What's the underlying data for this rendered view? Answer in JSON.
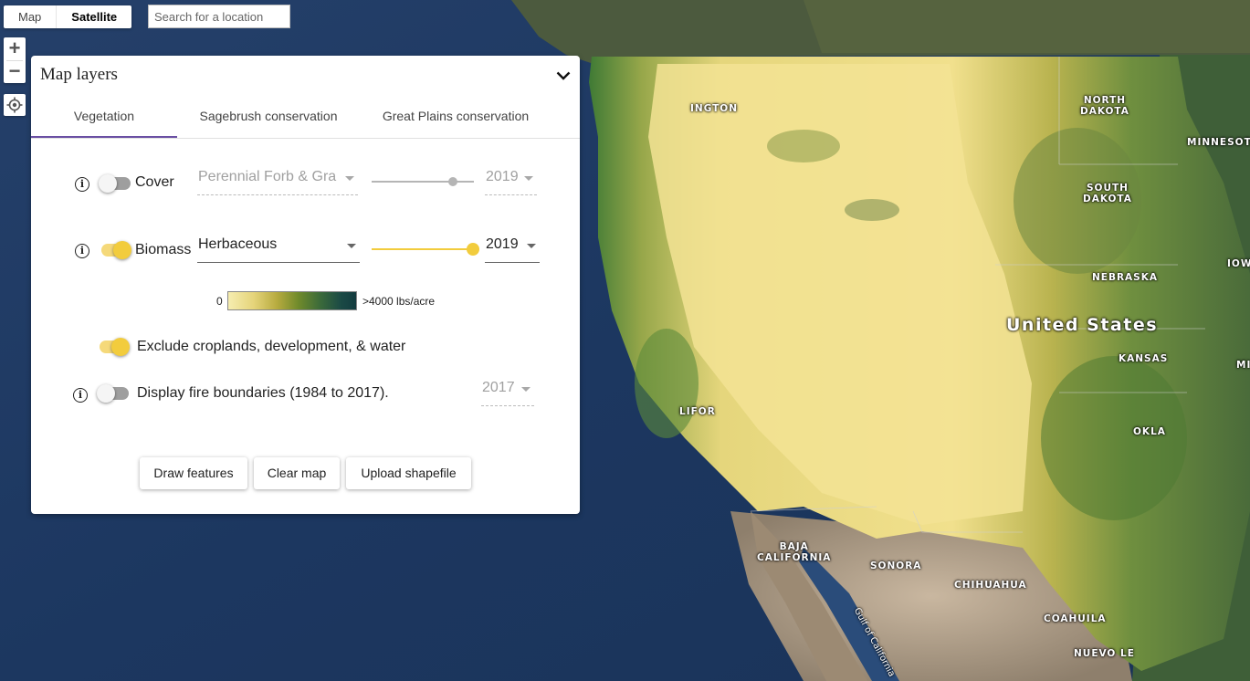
{
  "map": {
    "labels": [
      {
        "text": "NORTH\nDAKOTA",
        "name": "label-north-dakota"
      },
      {
        "text": "MINNESOTA",
        "name": "label-minnesota"
      },
      {
        "text": "SOUTH\nDAKOTA",
        "name": "label-south-dakota"
      },
      {
        "text": "NEBRASKA",
        "name": "label-nebraska"
      },
      {
        "text": "IOW",
        "name": "label-iowa"
      },
      {
        "text": "United States",
        "name": "label-united-states"
      },
      {
        "text": "KANSAS",
        "name": "label-kansas"
      },
      {
        "text": "MI",
        "name": "label-missouri"
      },
      {
        "text": "OKLA",
        "name": "label-oklahoma"
      },
      {
        "text": "INGTON",
        "name": "label-washington"
      },
      {
        "text": "LIFOR",
        "name": "label-california"
      },
      {
        "text": "BAJA\nCALIFORNIA",
        "name": "label-baja-california"
      },
      {
        "text": "SONORA",
        "name": "label-sonora"
      },
      {
        "text": "CHIHUAHUA",
        "name": "label-chihuahua"
      },
      {
        "text": "COAHUILA",
        "name": "label-coahuila"
      },
      {
        "text": "NUEVO LE",
        "name": "label-nuevo-leon"
      },
      {
        "text": "Gulf of California",
        "name": "label-gulf-of-california"
      }
    ]
  },
  "controls": {
    "map_type": [
      "Map",
      "Satellite"
    ],
    "active_map_type": "Satellite",
    "search_placeholder": "Search for a location",
    "zoom_in": "+",
    "zoom_out": "−"
  },
  "panel": {
    "title": "Map layers",
    "tabs": [
      "Vegetation",
      "Sagebrush conservation",
      "Great Plains conservation"
    ],
    "active_tab": "Vegetation",
    "cover": {
      "label": "Cover",
      "enabled": false,
      "type": "Perennial Forb & Gra…",
      "year": "2019"
    },
    "biomass": {
      "label": "Biomass",
      "enabled": true,
      "type": "Herbaceous",
      "year": "2019"
    },
    "legend": {
      "min": "0",
      "max": ">4000 lbs/acre"
    },
    "exclude": {
      "label": "Exclude croplands, development, & water",
      "enabled": true
    },
    "fire": {
      "label": "Display fire boundaries (1984 to 2017).",
      "enabled": false,
      "year": "2017"
    },
    "buttons": {
      "draw": "Draw features",
      "clear": "Clear map",
      "upload": "Upload shapefile"
    },
    "info_glyph": "i"
  },
  "colors": {
    "accent": "#f2cc3d",
    "tab_underline": "#6a4fa3"
  }
}
